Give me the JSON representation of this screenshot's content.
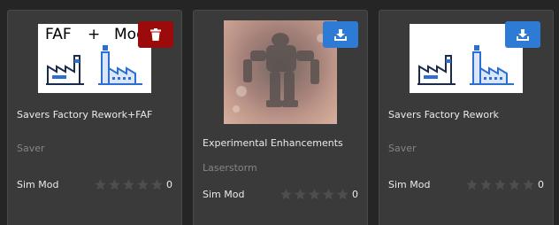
{
  "colors": {
    "background": "#252525",
    "card": "#3a3a3a",
    "delete_button": "#9b0b0b",
    "download_button": "#2e7bd6",
    "star_empty": "#4e4e4e",
    "factory_blue": "#2c6fd1"
  },
  "mods": [
    {
      "title": "Savers Factory Rework+FAF",
      "author": "Saver",
      "type": "Sim Mod",
      "rating": 0,
      "rating_count": "0",
      "action": "delete",
      "action_icon": "trash-icon",
      "thumbnail_caption_left": "FAF",
      "thumbnail_caption_plus": "+",
      "thumbnail_caption_right": "Mod"
    },
    {
      "title": "Experimental Enhancements",
      "author": "Laserstorm",
      "type": "Sim Mod",
      "rating": 0,
      "rating_count": "0",
      "action": "download",
      "action_icon": "download-icon"
    },
    {
      "title": "Savers Factory Rework",
      "author": "Saver",
      "type": "Sim Mod",
      "rating": 0,
      "rating_count": "0",
      "action": "download",
      "action_icon": "download-icon"
    }
  ]
}
